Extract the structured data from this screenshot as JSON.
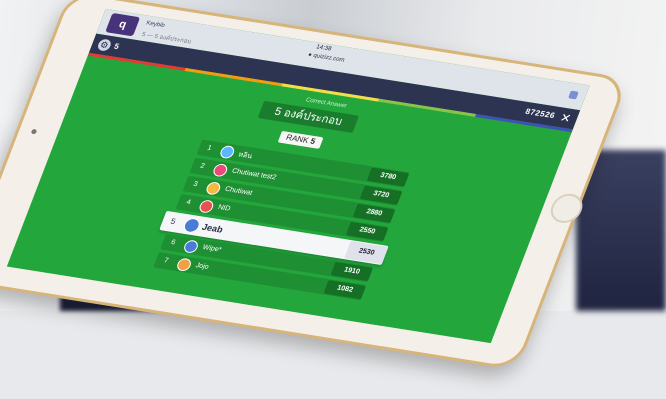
{
  "browser": {
    "tab_title": "Keybib",
    "tab_subtitle": "5 — 5 องค์ประกอบ",
    "time": "14:38",
    "url": "● quizizz.com",
    "logo_letter": "q"
  },
  "gamebar": {
    "player_count": "5",
    "game_pin": "872526",
    "close_icon": "✕",
    "gear_icon": "⚙"
  },
  "colorbar": [
    "#e53935",
    "#f39c12",
    "#f7dc4a",
    "#8bc34a",
    "#3f51b5"
  ],
  "question": {
    "correct_label": "Correct Answer",
    "answer": "5 องค์ประกอบ",
    "rank_label": "RANK",
    "rank_value": "5"
  },
  "leaderboard": [
    {
      "rank": "1",
      "name": "หลิน",
      "score": "3780",
      "avatar": "#5bb6ff"
    },
    {
      "rank": "2",
      "name": "Chutiwat test2",
      "score": "3720",
      "avatar": "#e94a7a"
    },
    {
      "rank": "3",
      "name": "Chutiwat",
      "score": "2880",
      "avatar": "#f5b942"
    },
    {
      "rank": "4",
      "name": "NID",
      "score": "2550",
      "avatar": "#e65151"
    },
    {
      "rank": "5",
      "name": "Jeab",
      "score": "2530",
      "avatar": "#4a7bd6"
    },
    {
      "rank": "6",
      "name": "Wipe*",
      "score": "1910",
      "avatar": "#4a7bd6"
    },
    {
      "rank": "7",
      "name": "Jojo",
      "score": "1082",
      "avatar": "#f0a040"
    }
  ],
  "highlight_rank": "5"
}
